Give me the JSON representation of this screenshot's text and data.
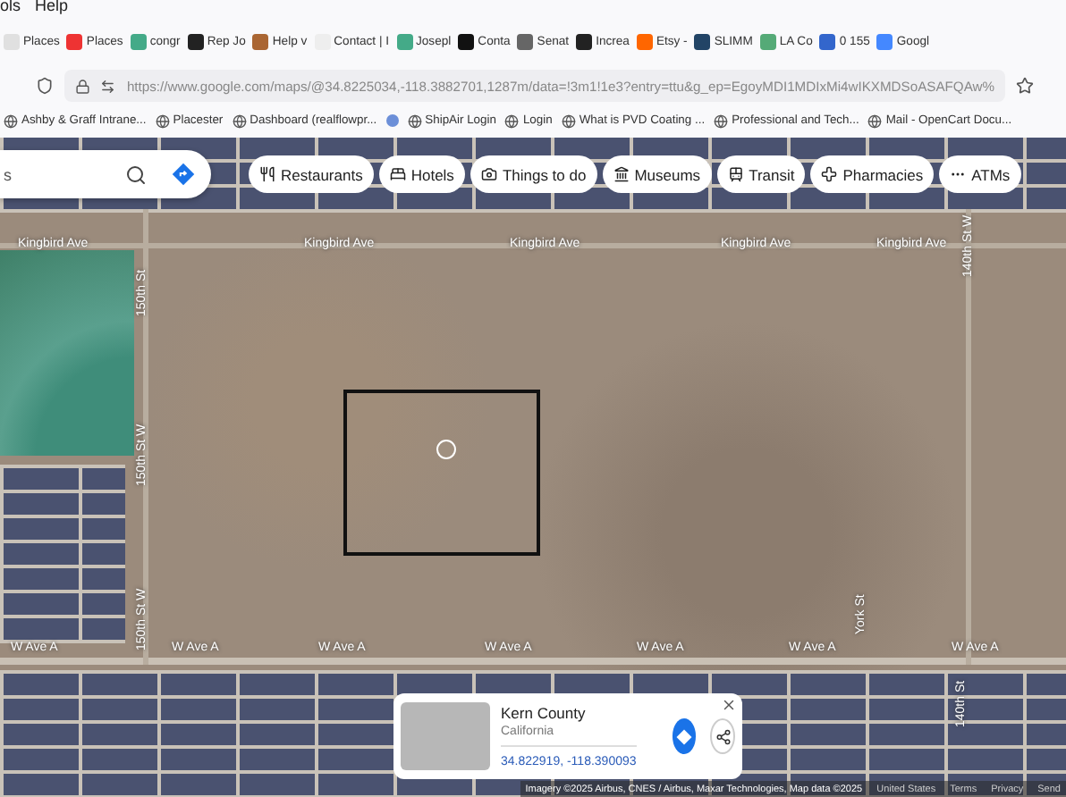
{
  "menu_bar": [
    "ols",
    "Help"
  ],
  "tabs": [
    {
      "label": "Places"
    },
    {
      "label": "Places"
    },
    {
      "label": "congr"
    },
    {
      "label": "Rep Jo"
    },
    {
      "label": "Help v"
    },
    {
      "label": "Contact | I"
    },
    {
      "label": "Josepl"
    },
    {
      "label": "Conta"
    },
    {
      "label": "Senat"
    },
    {
      "label": "Increa"
    },
    {
      "label": "Etsy -"
    },
    {
      "label": "SLIMM"
    },
    {
      "label": "LA Co"
    },
    {
      "label": "0 155"
    },
    {
      "label": "Googl"
    }
  ],
  "address_bar": {
    "url": "https://www.google.com/maps/@34.8225034,-118.3882701,1287m/data=!3m1!1e3?entry=ttu&g_ep=EgoyMDI1MDIxMi4wIKXMDSoASAFQAw%"
  },
  "bookmarks": [
    {
      "kind": "link",
      "label": "Ashby & Graff Intrane..."
    },
    {
      "kind": "link",
      "label": "Placester"
    },
    {
      "kind": "link",
      "label": "Dashboard (realflowpr..."
    },
    {
      "kind": "icon"
    },
    {
      "kind": "link",
      "label": "ShipAir Login"
    },
    {
      "kind": "link",
      "label": "Login"
    },
    {
      "kind": "link",
      "label": "What is PVD Coating ..."
    },
    {
      "kind": "link",
      "label": "Professional and Tech..."
    },
    {
      "kind": "link",
      "label": "Mail - OpenCart Docu..."
    }
  ],
  "map": {
    "search": {
      "value": "s"
    },
    "categories": [
      "Restaurants",
      "Hotels",
      "Things to do",
      "Museums",
      "Transit",
      "Pharmacies",
      "ATMs"
    ],
    "street_labels": [
      {
        "name": "Kingbird Ave"
      },
      {
        "name": "Kingbird Ave"
      },
      {
        "name": "Kingbird Ave"
      },
      {
        "name": "Kingbird Ave"
      },
      {
        "name": "Kingbird Ave"
      },
      {
        "name": "W Ave A"
      },
      {
        "name": "W Ave A"
      },
      {
        "name": "W Ave A"
      },
      {
        "name": "W Ave A"
      },
      {
        "name": "W Ave A"
      },
      {
        "name": "W Ave A"
      },
      {
        "name": "W Ave A"
      },
      {
        "name": "150th St"
      },
      {
        "name": "150th St W"
      },
      {
        "name": "150th St W"
      },
      {
        "name": "York St"
      },
      {
        "name": "140th St W"
      },
      {
        "name": "140th St"
      }
    ],
    "place_card": {
      "title": "Kern County",
      "subtitle": "California",
      "coordinates": "34.822919, -118.390093"
    },
    "attribution": [
      "Imagery ©2025 Airbus, CNES / Airbus, Maxar Technologies, Map data ©2025",
      "United States",
      "Terms",
      "Privacy",
      "Send"
    ]
  }
}
